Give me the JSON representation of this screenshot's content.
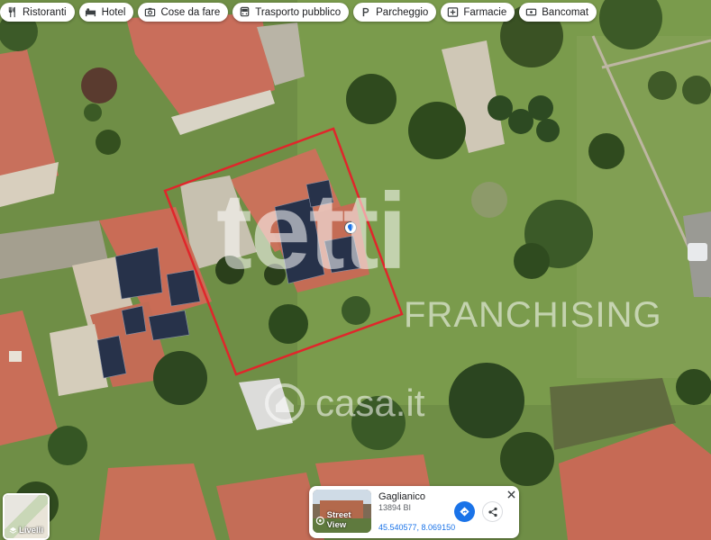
{
  "filters": [
    {
      "label": "Ristoranti",
      "icon": "fork-knife-icon"
    },
    {
      "label": "Hotel",
      "icon": "bed-icon"
    },
    {
      "label": "Cose da fare",
      "icon": "camera-icon"
    },
    {
      "label": "Trasporto pubblico",
      "icon": "bus-icon"
    },
    {
      "label": "Parcheggio",
      "icon": "parking-icon"
    },
    {
      "label": "Farmacie",
      "icon": "pharmacy-icon"
    },
    {
      "label": "Bancomat",
      "icon": "atm-icon"
    }
  ],
  "layers": {
    "label": "Livelli",
    "icon": "layers-icon"
  },
  "place_card": {
    "name": "Gaglianico",
    "postal": "13894 BI",
    "coordinates": "45.540577, 8.069150",
    "street_view_label": "Street View",
    "icons": [
      "street-view-icon",
      "directions-icon",
      "share-icon",
      "close-icon"
    ]
  },
  "watermarks": {
    "logo_partial": "tetti",
    "franchising": "FRANCHISING",
    "casa": "casa.it"
  },
  "colors": {
    "grass": "#6d8f43",
    "roof": "#c96e58",
    "boundary": "#e0262b",
    "accent": "#1a73e8"
  }
}
